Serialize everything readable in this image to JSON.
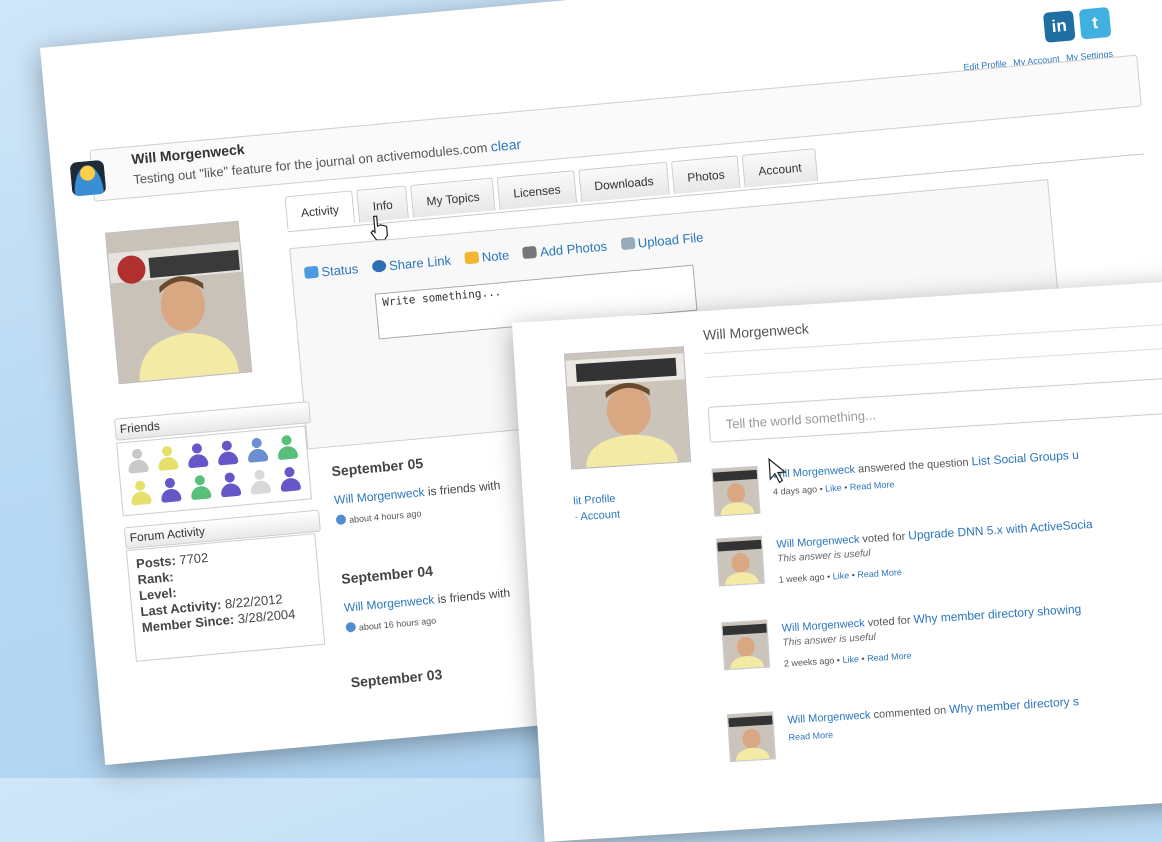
{
  "back": {
    "social": {
      "linkedin_label": "in",
      "twitter_label": "t"
    },
    "top_links": [
      "Edit Profile",
      "My Account",
      "My Settings"
    ],
    "header": {
      "name": "Will Morgenweck",
      "status": "Testing out \"like\" feature for the journal on activemodules.com",
      "clear_label": "clear"
    },
    "tabs": [
      "Activity",
      "Info",
      "My Topics",
      "Licenses",
      "Downloads",
      "Photos",
      "Account"
    ],
    "composer": {
      "tools": [
        "Status",
        "Share Link",
        "Note",
        "Add Photos",
        "Upload File"
      ],
      "placeholder": "Write something..."
    },
    "friends": {
      "label": "Friends"
    },
    "forum": {
      "label": "Forum Activity",
      "posts_label": "Posts:",
      "posts": "7702",
      "rank_label": "Rank:",
      "level_label": "Level:",
      "last_activity_label": "Last Activity:",
      "last_activity": "8/22/2012",
      "member_since_label": "Member Since:",
      "member_since": "3/28/2004"
    },
    "feed": [
      {
        "date": "September 05",
        "who": "Will Morgenweck",
        "text": "is friends with",
        "time": "about 4 hours ago"
      },
      {
        "date": "September 04",
        "who": "Will Morgenweck",
        "text": "is friends with",
        "time": "about 16 hours ago"
      },
      {
        "date": "September 03"
      }
    ]
  },
  "front": {
    "name": "Will Morgenweck",
    "input_placeholder": "Tell the world something...",
    "side_links": [
      "lit Profile",
      "· Account"
    ],
    "activities": [
      {
        "who": "Will Morgenweck",
        "action": "answered the question",
        "target": "List Social Groups u",
        "time": "4 days ago",
        "like": "Like",
        "more": "Read More"
      },
      {
        "who": "Will Morgenweck",
        "action": "voted for",
        "target": "Upgrade DNN 5.x with ActiveSocia",
        "note": "This answer is useful",
        "time": "1 week ago",
        "like": "Like",
        "more": "Read More"
      },
      {
        "who": "Will Morgenweck",
        "action": "voted for",
        "target": "Why member directory showing",
        "note": "This answer is useful",
        "time": "2 weeks ago",
        "like": "Like",
        "more": "Read More"
      },
      {
        "who": "Will Morgenweck",
        "action": "commented on",
        "target": "Why member directory s",
        "time": "",
        "like": "",
        "more": "Read More"
      }
    ]
  }
}
